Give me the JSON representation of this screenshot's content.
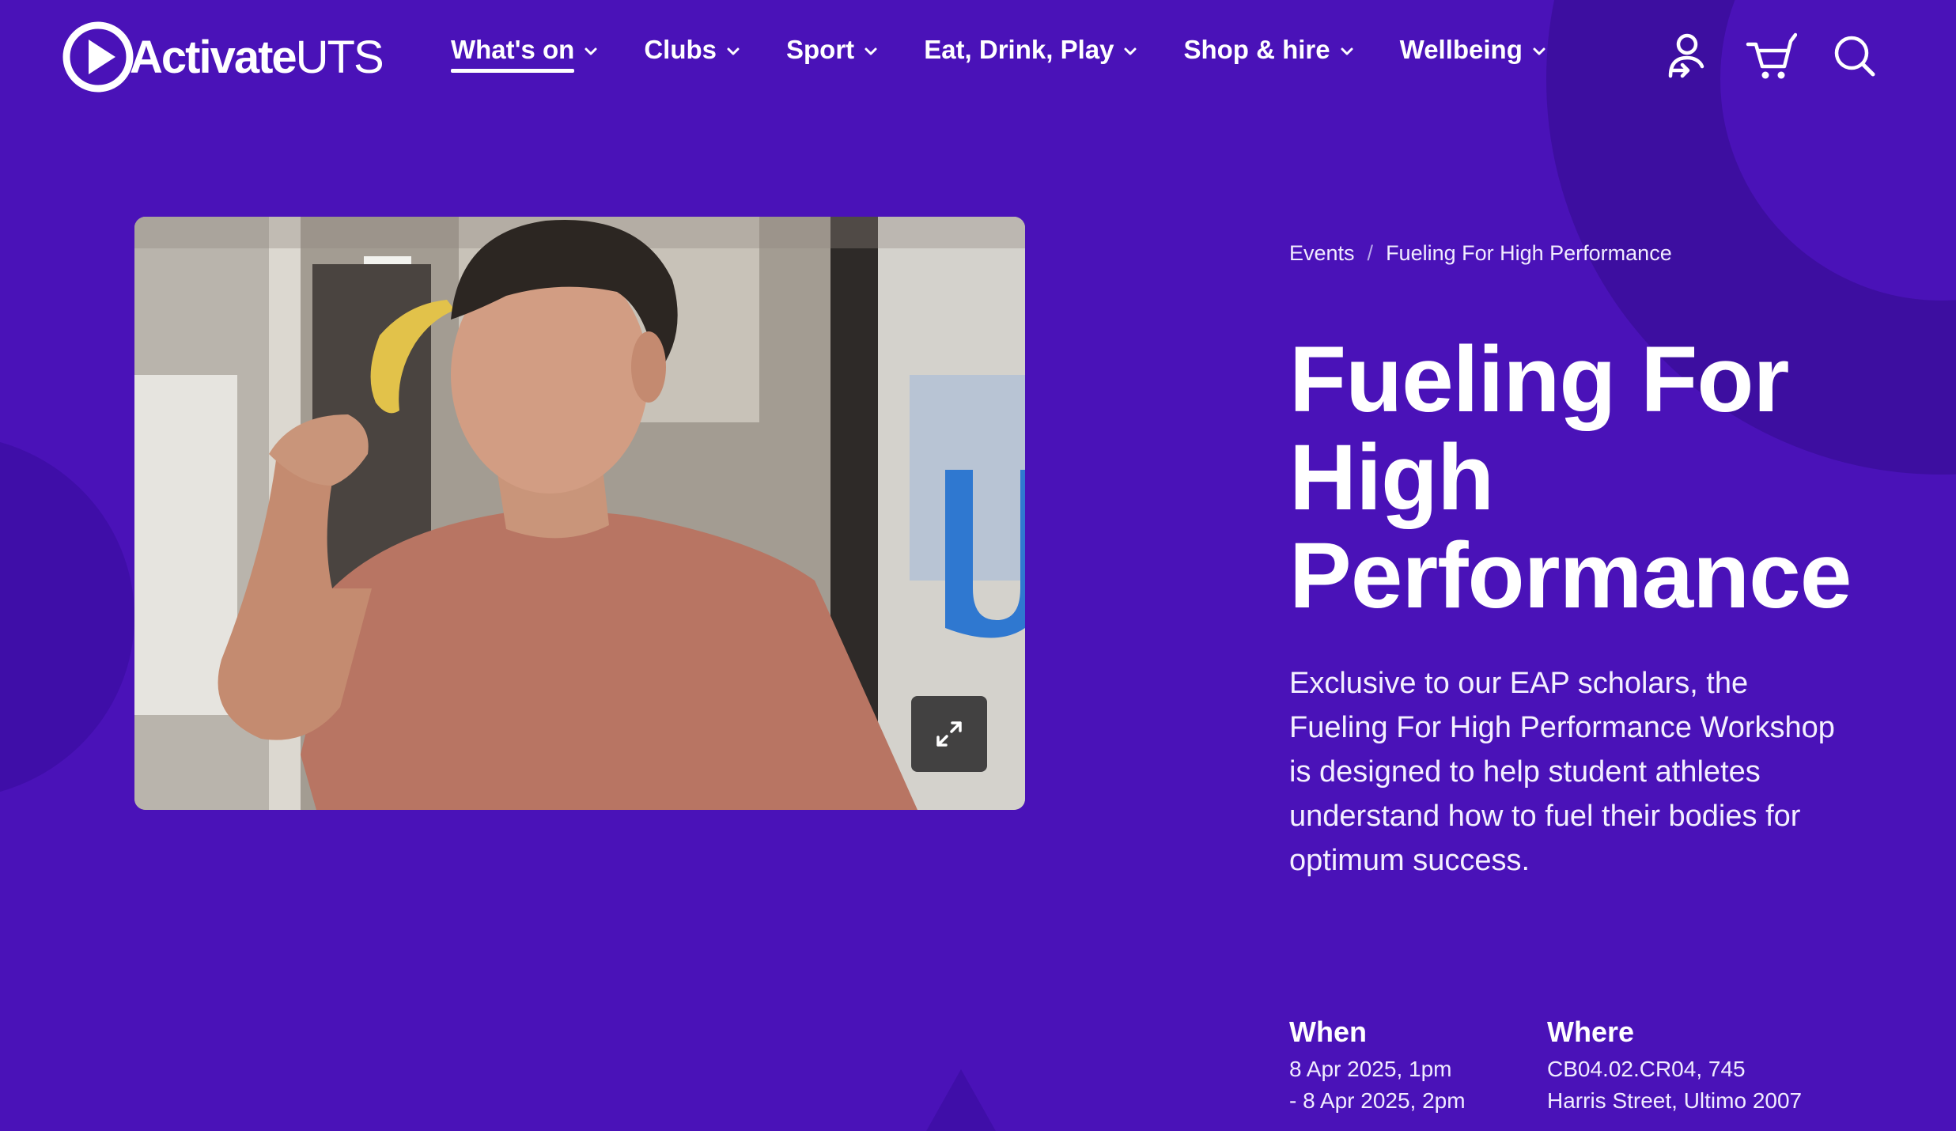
{
  "brand": {
    "name_bold": "Activate",
    "name_light": "UTS",
    "logo_icon": "play-circle-icon"
  },
  "nav": {
    "items": [
      {
        "label": "What's on",
        "active": true
      },
      {
        "label": "Clubs",
        "active": false
      },
      {
        "label": "Sport",
        "active": false
      },
      {
        "label": "Eat, Drink, Play",
        "active": false
      },
      {
        "label": "Shop & hire",
        "active": false
      },
      {
        "label": "Wellbeing",
        "active": false
      }
    ]
  },
  "header_icons": [
    "account-login-icon",
    "cart-icon",
    "search-icon"
  ],
  "hero": {
    "expand_icon": "expand-arrows-icon"
  },
  "breadcrumb": {
    "items": [
      "Events",
      "Fueling For High Performance"
    ],
    "separator": "/"
  },
  "event": {
    "title": "Fueling For High Performance",
    "description": "Exclusive to our EAP scholars, the Fueling For High Performance Workshop is designed to help student athletes understand how to fuel their bodies for optimum success.",
    "when_heading": "When",
    "when_lines": [
      "8 Apr 2025, 1pm",
      "- 8 Apr 2025, 2pm"
    ],
    "where_heading": "Where",
    "where_lines": [
      "CB04.02.CR04, 745",
      "Harris Street, Ultimo 2007"
    ]
  },
  "colors": {
    "background": "#4a12b8",
    "deco": "#3d0ea0",
    "text": "#ffffff"
  }
}
